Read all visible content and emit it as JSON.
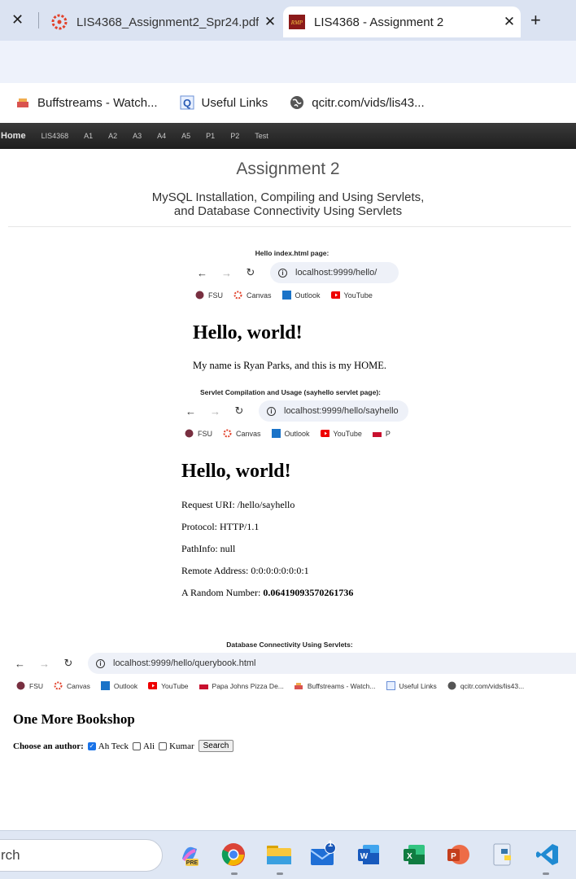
{
  "browser": {
    "tabs": [
      {
        "title": "LIS4368_Assignment2_Spr24.pdf",
        "active": false
      },
      {
        "title": "LIS4368 - Assignment 2",
        "active": true
      }
    ],
    "bookmarks": [
      {
        "label": "Buffstreams - Watch...",
        "icon": "buffstreams-icon"
      },
      {
        "label": "Useful Links",
        "icon": "q-icon"
      },
      {
        "label": "qcitr.com/vids/lis43...",
        "icon": "globe-icon"
      }
    ]
  },
  "site": {
    "nav": [
      "Home",
      "LIS4368",
      "A1",
      "A2",
      "A3",
      "A4",
      "A5",
      "P1",
      "P2",
      "Test"
    ],
    "title": "Assignment 2",
    "subtitle_line1": "MySQL Installation, Compiling and Using Servlets,",
    "subtitle_line2": "and Database Connectivity Using Servlets"
  },
  "shot1": {
    "caption": "Hello index.html page:",
    "url": "localhost:9999/hello/",
    "bookmarks": [
      "FSU",
      "Canvas",
      "Outlook",
      "YouTube"
    ],
    "heading": "Hello, world!",
    "text": "My name is Ryan Parks, and this is my HOME."
  },
  "shot2": {
    "caption": "Servlet Compilation and Usage (sayhello servlet page):",
    "url": "localhost:9999/hello/sayhello",
    "bookmarks": [
      "FSU",
      "Canvas",
      "Outlook",
      "YouTube",
      "P"
    ],
    "heading": "Hello, world!",
    "request_uri": "Request URI: /hello/sayhello",
    "protocol": "Protocol: HTTP/1.1",
    "pathinfo": "PathInfo: null",
    "remote": "Remote Address: 0:0:0:0:0:0:0:1",
    "random_label": "A Random Number: ",
    "random_value": "0.06419093570261736"
  },
  "shot3": {
    "caption": "Database Connectivity Using Servlets:",
    "url": "localhost:9999/hello/querybook.html",
    "bookmarks": [
      "FSU",
      "Canvas",
      "Outlook",
      "YouTube",
      "Papa Johns Pizza De...",
      "Buffstreams - Watch...",
      "Useful Links",
      "qcitr.com/vids/lis43..."
    ],
    "heading": "One More Bookshop",
    "choose_label": "Choose an author:",
    "authors": [
      {
        "name": "Ah Teck",
        "checked": true
      },
      {
        "name": "Ali",
        "checked": false
      },
      {
        "name": "Kumar",
        "checked": false
      }
    ],
    "search_button": "Search"
  },
  "taskbar": {
    "search_text": "rch",
    "mail_badge": "1"
  }
}
